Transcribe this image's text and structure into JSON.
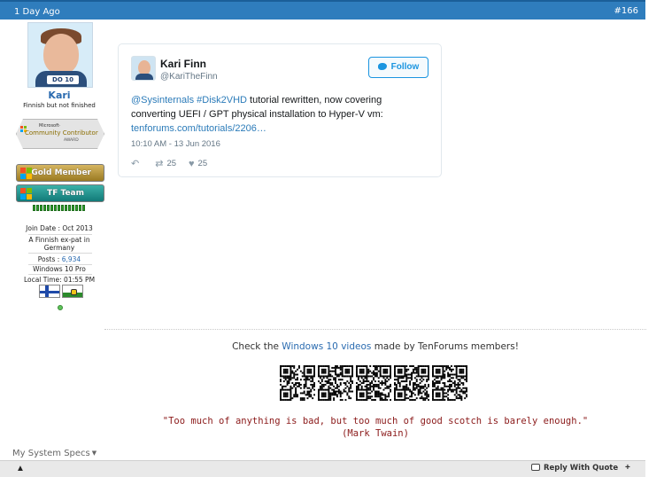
{
  "post": {
    "date": "1 Day Ago",
    "number": "#166"
  },
  "user": {
    "name": "Kari",
    "title": "Finnish but not finished",
    "avatar_badge": "DO 10",
    "mvp": {
      "brand": "Microsoft·",
      "line1": "Community Contributor",
      "line2": "AWARD"
    },
    "ranks": [
      "Gold Member",
      "TF Team"
    ],
    "info": {
      "join_label": "Join Date : ",
      "join_value": "Oct 2013",
      "location_line1": "A Finnish ex-pat in",
      "location_line2": "Germany",
      "posts_label": "Posts : ",
      "posts_value": "6,934",
      "os": "Windows 10 Pro",
      "time_label": "Local Time: ",
      "time_value": "01:55 PM"
    }
  },
  "tweet": {
    "name": "Kari Finn",
    "handle": "@KariTheFinn",
    "follow": "Follow",
    "text_links": "@Sysinternals #Disk2VHD",
    "text_body1": " tutorial rewritten, now covering",
    "text_body2": "converting UEFI / GPT physical installation to Hyper-V vm:",
    "text_url": "tenforums.com/tutorials/2206…",
    "time": "10:10 AM - 13 Jun 2016",
    "retweets": "25",
    "likes": "25"
  },
  "signature": {
    "pre": "Check the ",
    "link": "Windows 10 videos",
    "post": " made by TenForums members!",
    "quote_line1": "\"Too much of anything is bad, but too much of good scotch is barely enough.\"",
    "quote_line2": "(Mark Twain)"
  },
  "footer": {
    "specs": "My System Specs",
    "reply_quote": "Reply With Quote",
    "multi_quote": "+"
  },
  "colors": {
    "header": "#2f7dbd",
    "link": "#2a6bb0",
    "quote": "#8b1a1a",
    "twitter": "#1b95e0"
  }
}
